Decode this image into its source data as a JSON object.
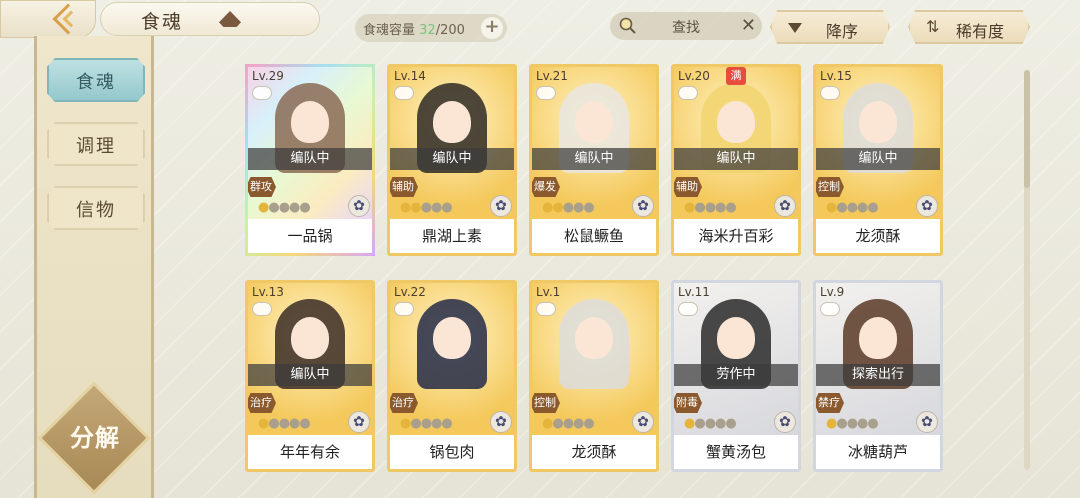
{
  "header": {
    "title": "食魂",
    "capacity_label": "食魂容量",
    "capacity_current": "32",
    "capacity_max": "/200",
    "plus": "+",
    "search_label": "查找",
    "search_clear": "✕",
    "sort_label": "降序",
    "rarity_label": "稀有度",
    "rarity_arrows": "⇅"
  },
  "sidebar": {
    "items": [
      {
        "label": "食魂",
        "active": true
      },
      {
        "label": "调理",
        "active": false
      },
      {
        "label": "信物",
        "active": false
      }
    ],
    "decompose_label": "分解"
  },
  "cards": [
    {
      "level": "Lv.29",
      "status": "编队中",
      "role": "群攻",
      "stars": 1,
      "name": "一品锅",
      "frame": "rainbow",
      "hair": "#8a6a55"
    },
    {
      "level": "Lv.14",
      "status": "编队中",
      "role": "辅助",
      "stars": 2,
      "name": "鼎湖上素",
      "frame": "gold",
      "hair": "#2e2a26"
    },
    {
      "level": "Lv.21",
      "status": "编队中",
      "role": "爆发",
      "stars": 2,
      "name": "松鼠鳜鱼",
      "frame": "gold",
      "hair": "#e8e6e2"
    },
    {
      "level": "Lv.20",
      "status": "编队中",
      "role": "辅助",
      "stars": 1,
      "name": "海米升百彩",
      "frame": "gold",
      "hair": "#f1d36e",
      "badge": "满"
    },
    {
      "level": "Lv.15",
      "status": "编队中",
      "role": "控制",
      "stars": 1,
      "name": "龙须酥",
      "frame": "gold",
      "hair": "#dcdcdc"
    },
    {
      "level": "Lv.13",
      "status": "编队中",
      "role": "治疗",
      "stars": 1,
      "name": "年年有余",
      "frame": "gold",
      "hair": "#3a2b24"
    },
    {
      "level": "Lv.22",
      "status": "",
      "role": "治疗",
      "stars": 1,
      "name": "锅包肉",
      "frame": "gold",
      "hair": "#232a48"
    },
    {
      "level": "Lv.1",
      "status": "",
      "role": "控制",
      "stars": 1,
      "name": "龙须酥",
      "frame": "gold",
      "hair": "#dcdcdc"
    },
    {
      "level": "Lv.11",
      "status": "劳作中",
      "role": "附毒",
      "stars": 1,
      "name": "蟹黄汤包",
      "frame": "silver",
      "hair": "#2a2a2a"
    },
    {
      "level": "Lv.9",
      "status": "探索出行",
      "role": "禁疗",
      "stars": 1,
      "name": "冰糖葫芦",
      "frame": "silver",
      "hair": "#5a3a26"
    }
  ],
  "total_stars": 5,
  "star_glyph": "●",
  "flower_glyph": "✿",
  "colors": {
    "gold_frame": "#f1c866",
    "silver_frame": "#d2d6de",
    "active_tab": "#94c8cc"
  }
}
